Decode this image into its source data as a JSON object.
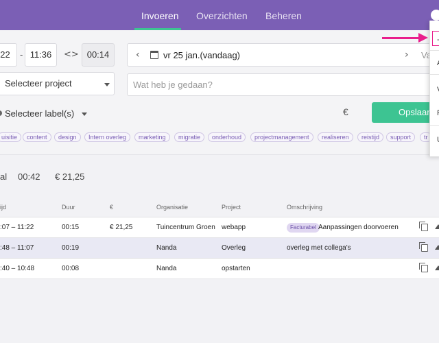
{
  "nav": {
    "tabs": [
      {
        "label": "Invoeren",
        "active": true
      },
      {
        "label": "Overzichten"
      },
      {
        "label": "Beheren"
      }
    ]
  },
  "entry": {
    "start_time": "22",
    "end_time": "11:36",
    "duration": "00:14",
    "dash": "-",
    "swap_icon": "<>",
    "date_label": "vr 25 jan.(vandaag)",
    "date_extra": "Va",
    "project_placeholder": "Selecteer project",
    "description_placeholder": "Wat heb je gedaan?",
    "label_placeholder": "Selecteer label(s)",
    "euro_symbol": "€",
    "save_label": "Opslaan"
  },
  "labels": [
    "uisitie",
    "content",
    "design",
    "Intern overleg",
    "marketing",
    "migratie",
    "onderhoud",
    "projectmanagement",
    "realiseren",
    "reistijd",
    "support",
    "tr"
  ],
  "summary": {
    "prefix": "al",
    "total_time": "00:42",
    "total_amount": "€ 21,25"
  },
  "table": {
    "headers": [
      "ijd",
      "Duur",
      "€",
      "Organisatie",
      "Project",
      "Omschrijving"
    ],
    "rows": [
      {
        "time": ":07 – 11:22",
        "duration": "00:15",
        "amount": "€ 21,25",
        "organisation": "Tuincentrum Groen",
        "project": "webapp",
        "badge": "Facturabel",
        "description": "Aanpassingen doorvoeren"
      },
      {
        "time": ":48 – 11:07",
        "duration": "00:19",
        "amount": "",
        "organisation": "Nanda",
        "project": "Overleg",
        "badge": "",
        "description": "overleg met collega's"
      },
      {
        "time": ":40 – 10:48",
        "duration": "00:08",
        "amount": "",
        "organisation": "Nanda",
        "project": "opstarten",
        "badge": "",
        "description": ""
      }
    ]
  },
  "dropdown_menu": {
    "items": [
      "-",
      "A",
      "V",
      "P",
      "U"
    ]
  },
  "colors": {
    "nav_bg": "#7b5fb5",
    "accent_green": "#3dc492",
    "annotation_pink": "#e91e8c"
  }
}
